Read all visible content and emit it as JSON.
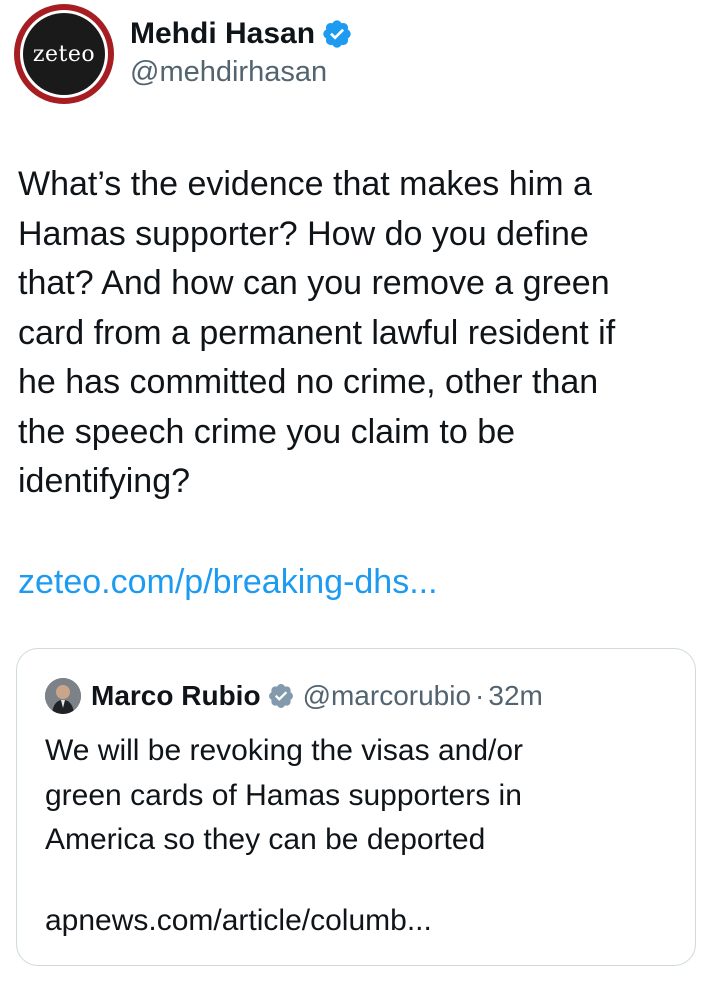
{
  "tweet": {
    "avatar": {
      "logo_text": "zeteo",
      "ring_color": "#a61e22"
    },
    "author": {
      "name": "Mehdi Hasan",
      "handle": "@mehdirhasan",
      "verified": true
    },
    "text": "What’s the evidence that makes him a\nHamas supporter? How do you define\nthat? And how can you remove a green\ncard from a permanent lawful resident if\nhe has committed no crime, other than\nthe speech crime you claim to be\nidentifying?",
    "link": "zeteo.com/p/breaking-dhs...",
    "link_color": "#1d9bf0"
  },
  "quote": {
    "author": {
      "name": "Marco Rubio",
      "handle": "@marcorubio",
      "verified": true,
      "badge_color": "#829aab"
    },
    "separator": "·",
    "time": "32m",
    "text": "We will be revoking the visas and/or\ngreen cards of Hamas supporters in\nAmerica so they can be deported",
    "link": "apnews.com/article/columb..."
  },
  "colors": {
    "verified_blue": "#1d9bf0",
    "secondary_text": "#536471",
    "border": "#cfd9de"
  }
}
